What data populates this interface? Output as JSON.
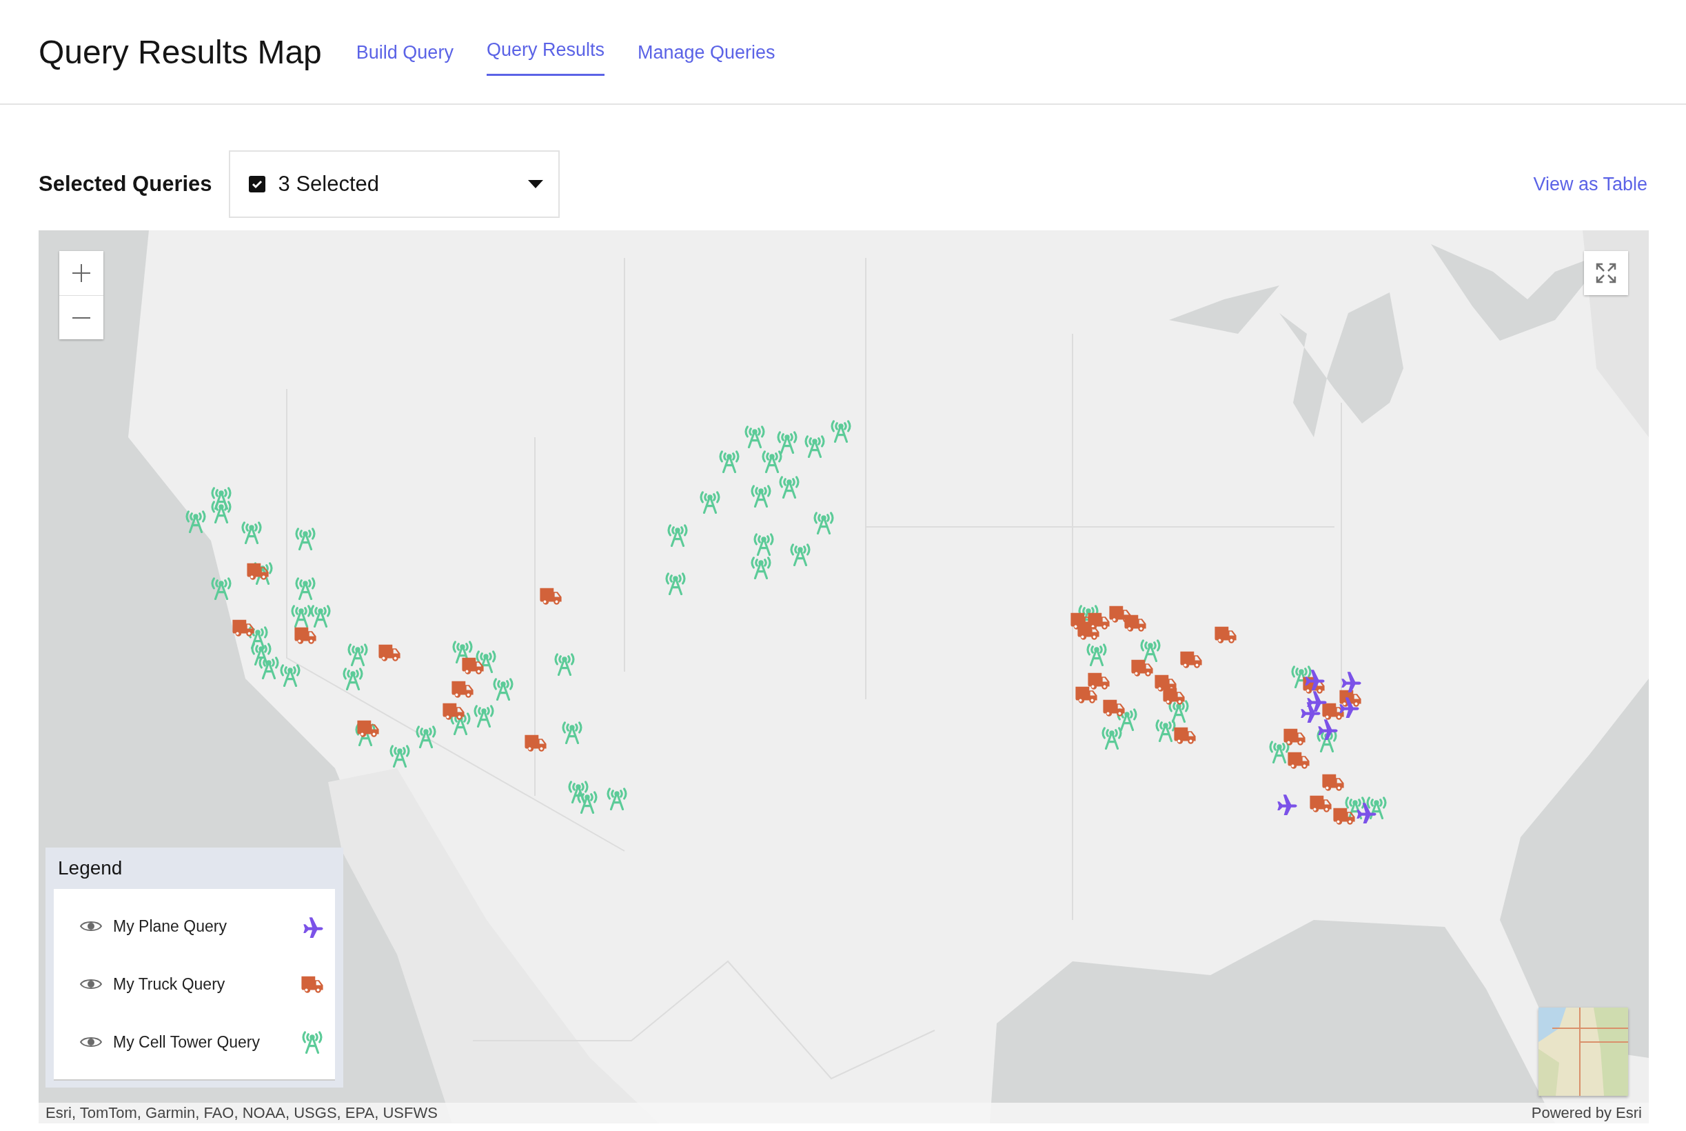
{
  "header": {
    "title": "Query Results Map"
  },
  "tabs": [
    {
      "label": "Build Query",
      "selected": false
    },
    {
      "label": "Query Results",
      "selected": true
    },
    {
      "label": "Manage Queries",
      "selected": false
    }
  ],
  "filter": {
    "label": "Selected Queries",
    "checked": true,
    "value": "3 Selected"
  },
  "view_link": "View as Table",
  "legend": {
    "title": "Legend",
    "items": [
      {
        "label": "My Plane Query",
        "kind": "plane",
        "visible": true
      },
      {
        "label": "My Truck Query",
        "kind": "truck",
        "visible": true
      },
      {
        "label": "My Cell Tower Query",
        "kind": "tower",
        "visible": true
      }
    ]
  },
  "attribution": "Esri, TomTom, Garmin, FAO, NOAA, USGS, EPA, USFWS",
  "powered_by": "Powered by Esri"
}
